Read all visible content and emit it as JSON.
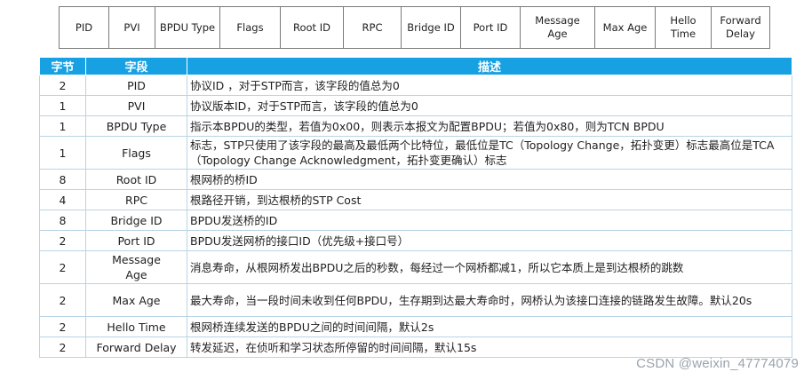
{
  "header_fields": [
    "PID",
    "PVI",
    "BPDU Type",
    "Flags",
    "Root ID",
    "RPC",
    "Bridge ID",
    "Port ID",
    "Message\nAge",
    "Max Age",
    "Hello\nTime",
    "Forward\nDelay"
  ],
  "table": {
    "columns": [
      "字节",
      "字段",
      "描述"
    ],
    "rows": [
      {
        "bytes": "2",
        "field": "PID",
        "desc": "协议ID ，对于STP而言，该字段的值总为0"
      },
      {
        "bytes": "1",
        "field": "PVI",
        "desc": "协议版本ID，对于STP而言，该字段的值总为0"
      },
      {
        "bytes": "1",
        "field": "BPDU Type",
        "desc": "指示本BPDU的类型，若值为0x00，则表示本报文为配置BPDU；若值为0x80，则为TCN BPDU"
      },
      {
        "bytes": "1",
        "field": "Flags",
        "desc": "标志，STP只使用了该字段的最高及最低两个比特位，最低位是TC（Topology  Change，拓扑变更）标志最高位是TCA（Topology Change Acknowledgment，拓扑变更确认）标志"
      },
      {
        "bytes": "8",
        "field": "Root ID",
        "desc": "根网桥的桥ID"
      },
      {
        "bytes": "4",
        "field": "RPC",
        "desc": "根路径开销，到达根桥的STP Cost"
      },
      {
        "bytes": "8",
        "field": "Bridge ID",
        "desc": "BPDU发送桥的ID"
      },
      {
        "bytes": "2",
        "field": "Port ID",
        "desc": "BPDU发送网桥的接口ID（优先级+接口号）"
      },
      {
        "bytes": "2",
        "field": "Message\nAge",
        "desc": "消息寿命，从根网桥发出BPDU之后的秒数，每经过一个网桥都减1，所以它本质上是到达根桥的跳数"
      },
      {
        "bytes": "2",
        "field": "Max Age",
        "desc": "最大寿命，当一段时间未收到任何BPDU，生存期到达最大寿命时，网桥认为该接口连接的链路发生故障。默认20s"
      },
      {
        "bytes": "2",
        "field": "Hello Time",
        "desc": "根网桥连续发送的BPDU之间的时间间隔，默认2s"
      },
      {
        "bytes": "2",
        "field": "Forward Delay",
        "desc": "转发延迟，在侦听和学习状态所停留的时间间隔，默认15s"
      }
    ]
  },
  "watermark": "CSDN @weixin_47774079",
  "colors": {
    "header_bg": "#17a1e3",
    "border": "#b9d4e4"
  }
}
